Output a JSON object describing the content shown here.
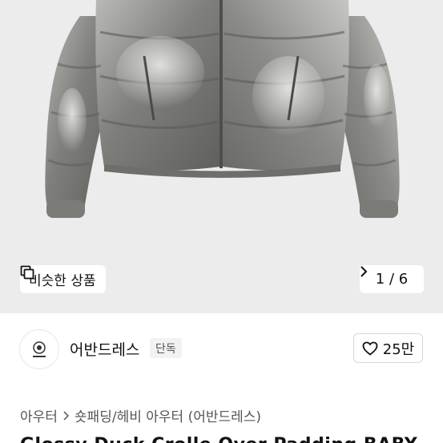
{
  "gallery": {
    "similar_label": "비슷한 상품",
    "counter": "1 / 6"
  },
  "shop": {
    "name": "어반드레스",
    "badge": "단독",
    "likes": "25만"
  },
  "breadcrumb": {
    "category": "아우터",
    "subcategory": "숏패딩/헤비 아우터 (어반드레스)"
  },
  "product": {
    "title_partial": "Glossy Duck Crolle Over Padding BABY"
  },
  "icons": {
    "similar": "overlapping-squares-icon",
    "next": "chevron-right-icon",
    "like": "heart-outline-icon",
    "separator": "chevron-right-icon"
  },
  "colors": {
    "hero_bg": "#ececec",
    "jacket": "#8f8f8c"
  }
}
